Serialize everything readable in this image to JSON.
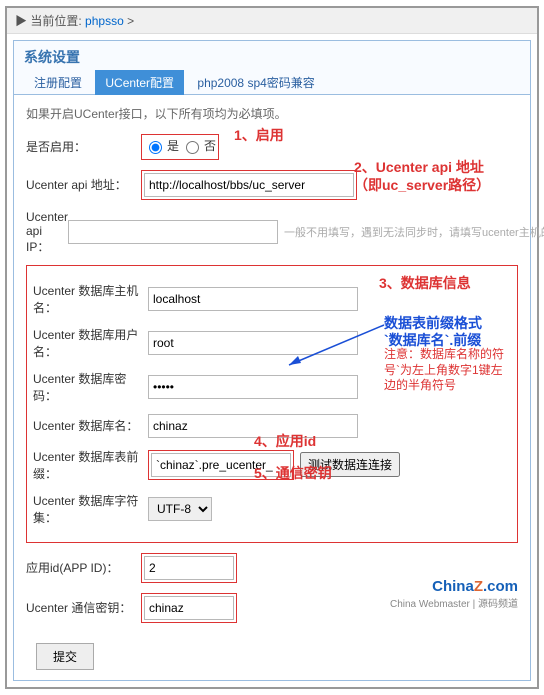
{
  "breadcrumb": {
    "icon": "▶",
    "label": "当前位置:",
    "link": "phpsso",
    "sep": " > "
  },
  "title": "系统设置",
  "tabs": [
    {
      "label": "注册配置",
      "active": false
    },
    {
      "label": "UCenter配置",
      "active": true
    },
    {
      "label": "php2008 sp4密码兼容",
      "active": false
    }
  ],
  "hint": "如果开启UCenter接口，以下所有项均为必填项。",
  "fields": {
    "enable": {
      "label": "是否启用：",
      "yes": "是",
      "no": "否"
    },
    "api": {
      "label": "Ucenter api 地址：",
      "value": "http://localhost/bbs/uc_server"
    },
    "ip": {
      "label": "Ucenter api IP：",
      "value": "",
      "hint": "一般不用填写，遇到无法同步时，请填写ucenter主机的IP地址"
    },
    "dbhost": {
      "label": "Ucenter 数据库主机名：",
      "value": "localhost"
    },
    "dbuser": {
      "label": "Ucenter 数据库用户名：",
      "value": "root"
    },
    "dbpwd": {
      "label": "Ucenter 数据库密码：",
      "value": "•••••"
    },
    "dbname": {
      "label": "Ucenter 数据库名：",
      "value": "chinaz"
    },
    "dbpre": {
      "label": "Ucenter 数据库表前缀：",
      "value": "`chinaz`.pre_ucenter_",
      "btn": "测试数据连连接"
    },
    "charset": {
      "label": "Ucenter 数据库字符集：",
      "value": "UTF-8"
    },
    "appid": {
      "label": "应用id(APP ID)：",
      "value": "2"
    },
    "key": {
      "label": "Ucenter 通信密钥：",
      "value": "chinaz"
    }
  },
  "submit": "提交",
  "annotations": {
    "a1": "1、启用",
    "a2a": "2、Ucenter api 地址",
    "a2b": "（即uc_server路径）",
    "a3": "3、数据库信息",
    "a4": "4、应用id",
    "a5": "5、通信密钥",
    "pfx1": "数据表前缀格式",
    "pfx2": "`数据库名`.前缀",
    "pfx3": "注意：数据库名称的符号`为左上角数字1键左边的半角符号"
  },
  "logo": {
    "t1": "China",
    "t2": "Z",
    "t3": ".com",
    "sub": "China Webmaster | 源码频道"
  }
}
